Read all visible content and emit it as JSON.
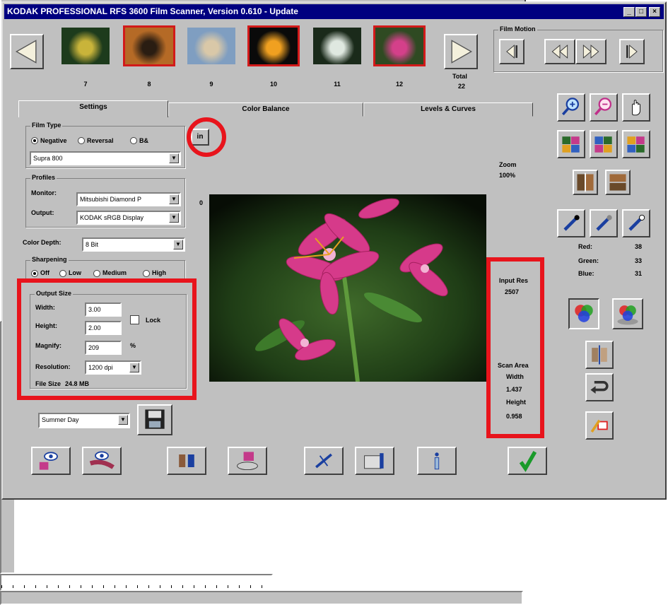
{
  "window": {
    "title": "KODAK PROFESSIONAL RFS 3600 Film Scanner, Version 0.610 - Update",
    "min": "_",
    "max": "□",
    "close": "×"
  },
  "film_strip": {
    "thumbs": [
      {
        "num": "7",
        "selected": false,
        "colors": [
          "#1d3b1c",
          "#c9b43a"
        ]
      },
      {
        "num": "8",
        "selected": true,
        "colors": [
          "#b56a26",
          "#2a1d12"
        ]
      },
      {
        "num": "9",
        "selected": false,
        "colors": [
          "#7f9ec1",
          "#d9c8a8"
        ]
      },
      {
        "num": "10",
        "selected": true,
        "colors": [
          "#0a0a0a",
          "#f0a020"
        ]
      },
      {
        "num": "11",
        "selected": false,
        "colors": [
          "#1a2a1a",
          "#dfe8e0"
        ]
      },
      {
        "num": "12",
        "selected": true,
        "colors": [
          "#2f4a22",
          "#d4408a"
        ]
      }
    ],
    "total_label": "Total",
    "total_value": "22"
  },
  "film_motion": {
    "label": "Film Motion"
  },
  "tabs": [
    {
      "label": "Settings"
    },
    {
      "label": "Color Balance"
    },
    {
      "label": "Levels & Curves"
    }
  ],
  "settings": {
    "film_type": {
      "legend": "Film Type",
      "options": [
        "Negative",
        "Reversal",
        "B&"
      ],
      "selected": "Negative",
      "film": "Supra 800"
    },
    "profiles": {
      "legend": "Profiles",
      "monitor_label": "Monitor:",
      "monitor_value": "Mitsubishi Diamond P",
      "output_label": "Output:",
      "output_value": "KODAK sRGB Display"
    },
    "color_depth": {
      "label": "Color Depth:",
      "value": "8 Bit"
    },
    "sharpening": {
      "legend": "Sharpening",
      "options": [
        "Off",
        "Low",
        "Medium",
        "High"
      ],
      "selected": "Off"
    },
    "output_size": {
      "legend": "Output Size",
      "width_label": "Width:",
      "width_value": "3.00",
      "height_label": "Height:",
      "height_value": "2.00",
      "lock_label": "Lock",
      "magnify_label": "Magnify:",
      "magnify_value": "209",
      "percent": "%",
      "resolution_label": "Resolution:",
      "resolution_value": "1200 dpi",
      "filesize_label": "File Size",
      "filesize_value": "24.8 MB"
    },
    "preset": "Summer Day"
  },
  "ruler": {
    "unit": "in",
    "zero": "0"
  },
  "zoom": {
    "label": "Zoom",
    "value": "100%"
  },
  "color_readout": {
    "red_label": "Red:",
    "red": "38",
    "green_label": "Green:",
    "green": "33",
    "blue_label": "Blue:",
    "blue": "31"
  },
  "scan_info": {
    "input_res_label": "Input Res",
    "input_res": "2507",
    "scan_area_label": "Scan Area",
    "width_label": "Width",
    "width": "1.437",
    "height_label": "Height",
    "height": "0.958"
  },
  "status_bar": {
    "text": ""
  }
}
